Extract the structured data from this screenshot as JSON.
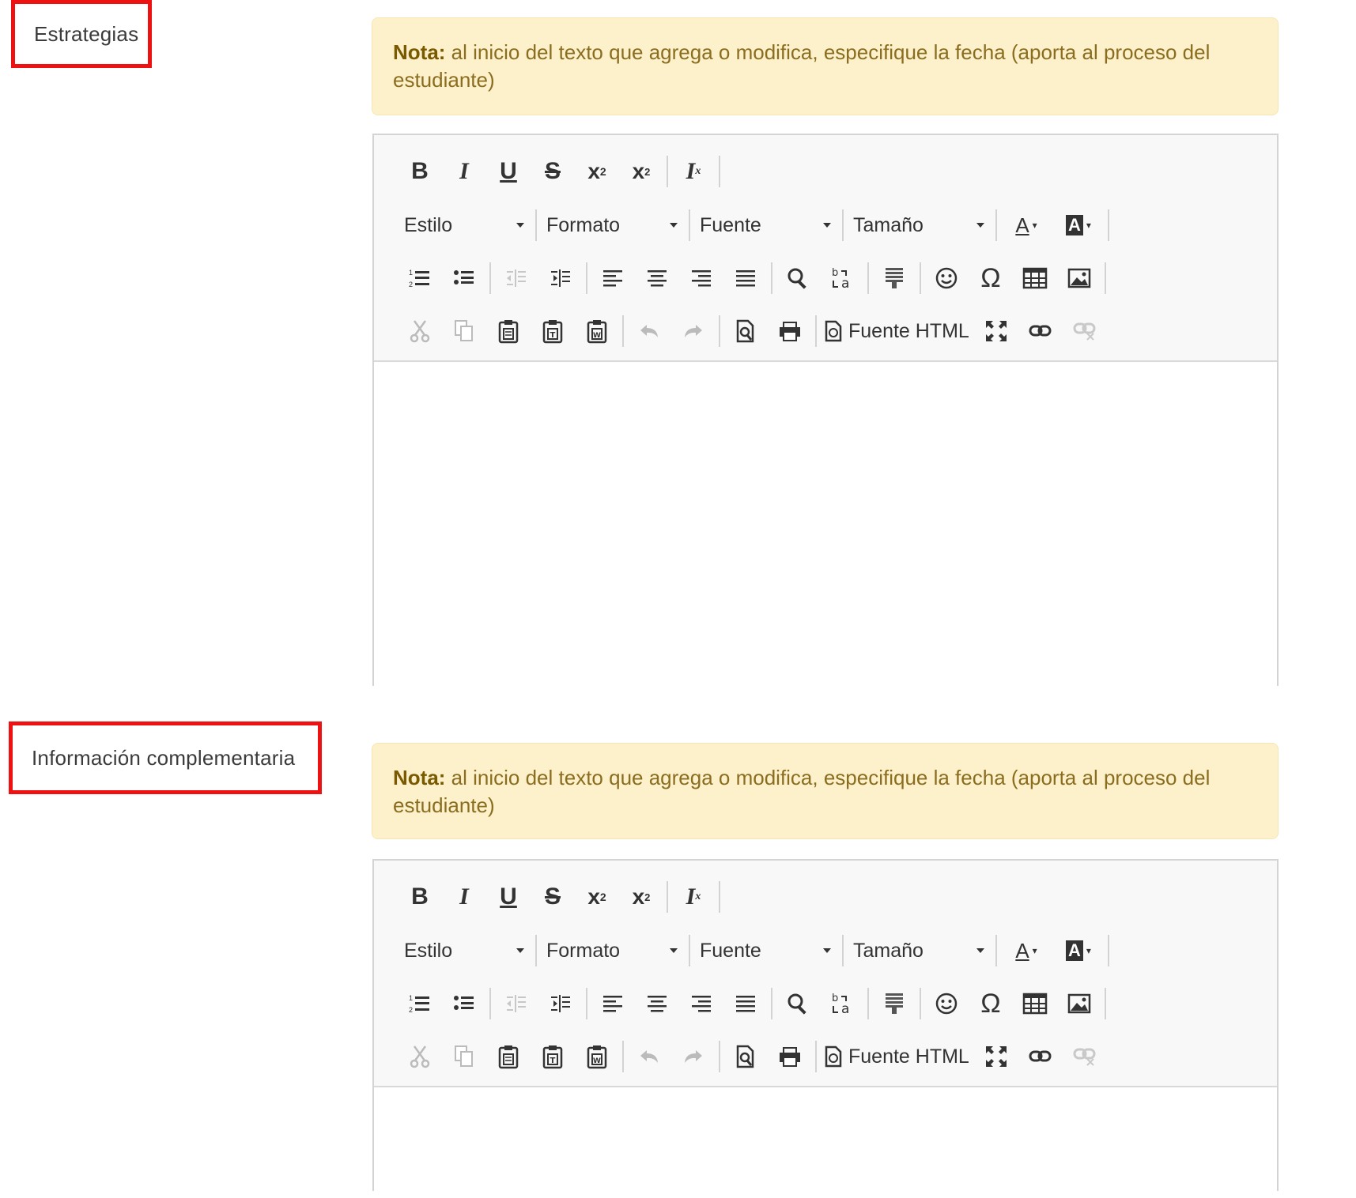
{
  "sections": [
    {
      "label": "Estrategias",
      "note_bold": "Nota:",
      "note_text": " al inicio del texto que agrega o modifica, especifique la fecha (aporta al proceso del estudiante)"
    },
    {
      "label": "Información complementaria",
      "note_bold": "Nota:",
      "note_text": " al inicio del texto que agrega o modifica, especifique la fecha (aporta al proceso del estudiante)"
    }
  ],
  "toolbar": {
    "combos": [
      "Estilo",
      "Formato",
      "Fuente",
      "Tamaño"
    ],
    "source_label": "Fuente HTML",
    "icons_row1": [
      "bold-icon",
      "italic-icon",
      "underline-icon",
      "strikethrough-icon",
      "subscript-icon",
      "superscript-icon",
      "remove-format-icon"
    ],
    "icons_row3": [
      "numbered-list-icon",
      "bulleted-list-icon",
      "decrease-indent-icon",
      "increase-indent-icon",
      "align-left-icon",
      "align-center-icon",
      "align-right-icon",
      "justify-icon",
      "find-icon",
      "replace-icon",
      "block-icon",
      "smiley-icon",
      "omega-icon",
      "table-icon",
      "image-icon"
    ],
    "icons_row4": [
      "cut-icon",
      "copy-icon",
      "paste-icon",
      "paste-text-icon",
      "paste-word-icon",
      "undo-icon",
      "redo-icon",
      "preview-icon",
      "print-icon",
      "source-icon",
      "maximize-icon",
      "link-icon",
      "unlink-icon"
    ]
  },
  "colors": {
    "highlight_border": "#ee1111",
    "note_bg": "#fdf1cb",
    "note_text": "#8a6d1f"
  }
}
